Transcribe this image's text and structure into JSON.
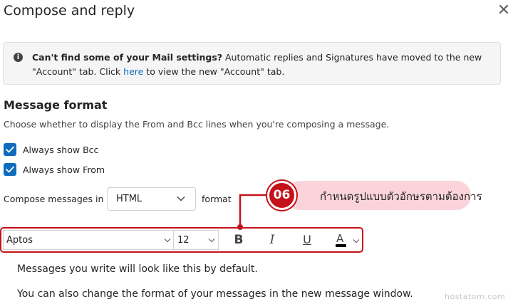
{
  "dialog": {
    "title": "Compose and reply",
    "close_glyph": "✕"
  },
  "info_bar": {
    "icon": "info-icon",
    "bold_text": "Can't find some of your Mail settings?",
    "text_part1": " Automatic replies and Signatures have moved to the new \"Account\" tab. Click ",
    "link_text": "here",
    "text_part2": " to view the new \"Account\" tab."
  },
  "message_format": {
    "heading": "Message format",
    "description": "Choose whether to display the From and Bcc lines when you're composing a message.",
    "checkboxes": [
      {
        "label": "Always show Bcc",
        "checked": true
      },
      {
        "label": "Always show From",
        "checked": true
      }
    ],
    "compose_label": "Compose messages in",
    "compose_format": "HTML",
    "format_suffix": "format"
  },
  "callout": {
    "number": "06",
    "text": "กำหนดรูปแบบตัวอักษรตามต้องการ",
    "pill_color": "#fbd4db",
    "badge_color": "#c4121a"
  },
  "toolbar": {
    "font_name": "Aptos",
    "font_size": "12",
    "bold_glyph": "B",
    "italic_glyph": "I",
    "underline_glyph": "U",
    "font_color_glyph": "A",
    "font_color": "#000000"
  },
  "preview": {
    "line1": "Messages you write will look like this by default.",
    "line2": "You can also change the format of your messages in the new message window."
  },
  "watermark": "hostatom.com",
  "colors": {
    "accent": "#0f6cbd",
    "highlight_red": "#c4121a"
  }
}
